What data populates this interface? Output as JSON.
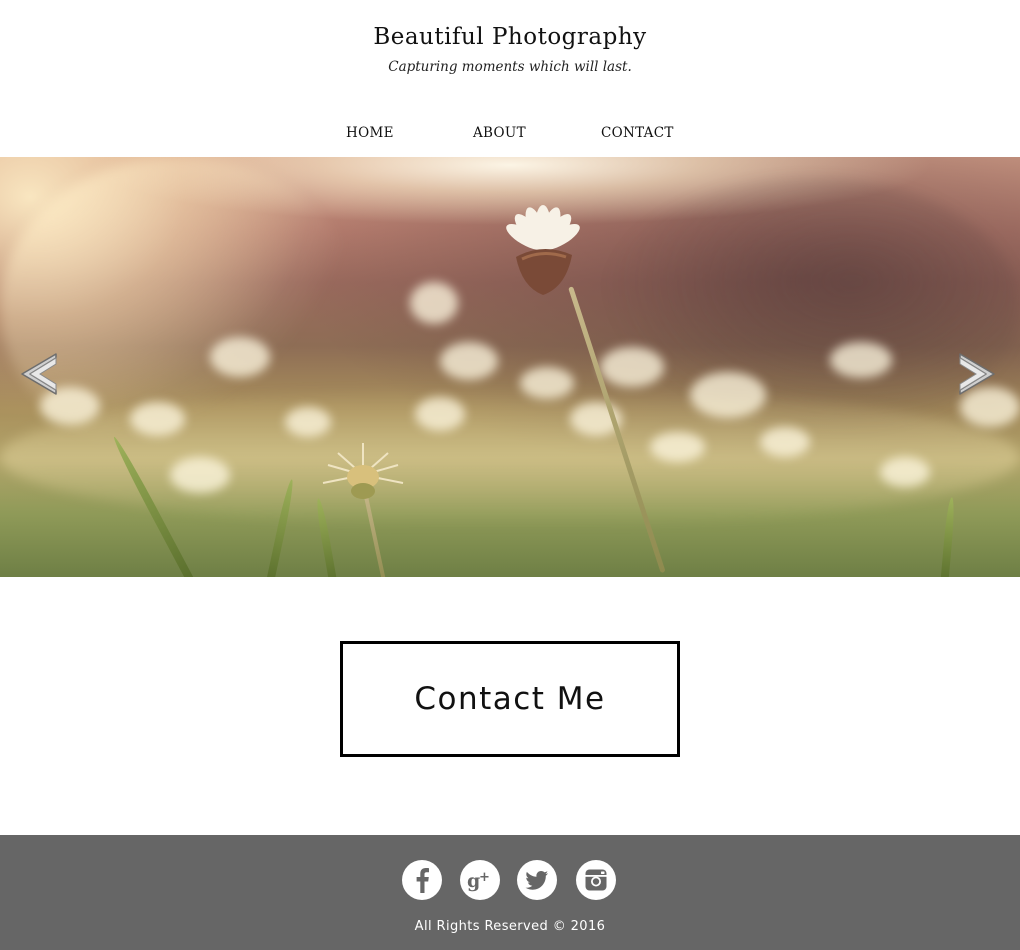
{
  "header": {
    "title": "Beautiful Photography",
    "tagline": "Capturing moments which will last."
  },
  "nav": {
    "items": [
      {
        "label": "HOME"
      },
      {
        "label": "ABOUT"
      },
      {
        "label": "CONTACT"
      }
    ]
  },
  "slider": {
    "image": "sunlit-daisy-field-photo",
    "prev_icon": "chevron-left-icon",
    "next_icon": "chevron-right-icon"
  },
  "cta": {
    "label": "Contact Me"
  },
  "footer": {
    "social": [
      {
        "icon": "facebook-icon"
      },
      {
        "icon": "google-plus-icon"
      },
      {
        "icon": "twitter-icon"
      },
      {
        "icon": "instagram-icon"
      }
    ],
    "copyright": "All Rights Reserved © 2016"
  },
  "colors": {
    "footer_bg": "#666666",
    "text": "#111111",
    "cta_border": "#000000"
  }
}
